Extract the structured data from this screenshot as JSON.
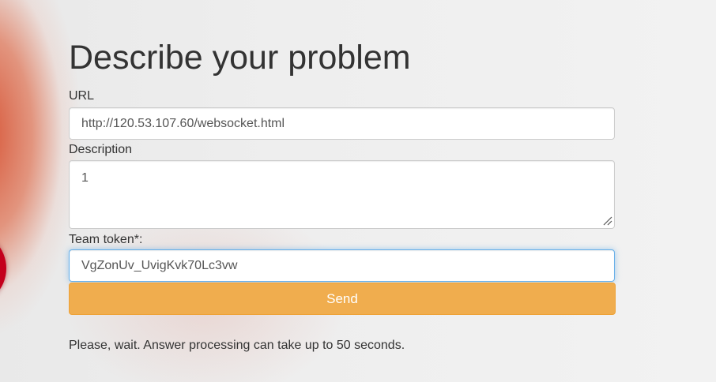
{
  "page": {
    "title": "Describe your problem"
  },
  "form": {
    "url_label": "URL",
    "url_value": "http://120.53.107.60/websocket.html",
    "description_label": "Description",
    "description_value": "1",
    "token_label": "Team token*:",
    "token_value": "VgZonUv_UvigKvk70Lc3vw",
    "send_label": "Send"
  },
  "status": {
    "message": "Please, wait. Answer processing can take up to 50 seconds."
  },
  "colors": {
    "button_bg": "#f0ad4e",
    "focus_border": "#66afe9",
    "text": "#333333"
  }
}
